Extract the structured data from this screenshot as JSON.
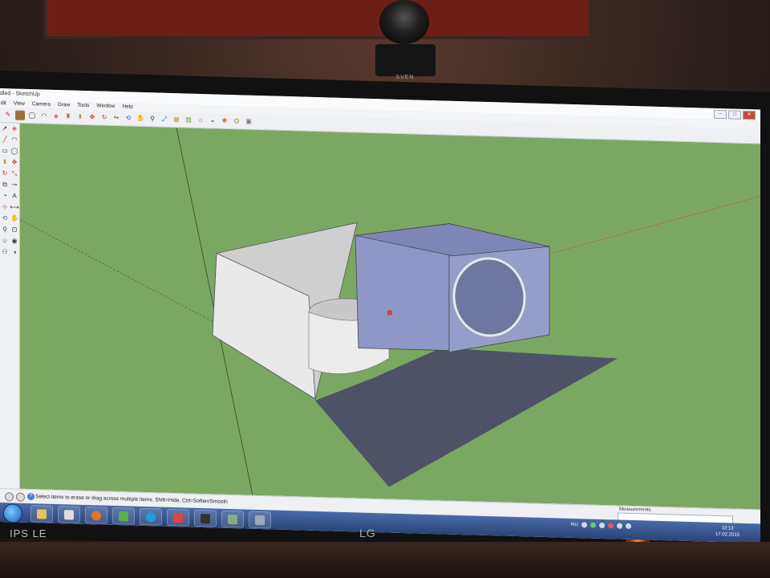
{
  "window": {
    "title": "dled - SketchUp",
    "controls": [
      "–",
      "□",
      "✕"
    ]
  },
  "menu": [
    "dit",
    "View",
    "Camera",
    "Draw",
    "Tools",
    "Window",
    "Help"
  ],
  "toolbar_icons": [
    "pencil-icon",
    "rectangle-icon",
    "circle-icon",
    "arc-icon",
    "eraser-icon",
    "paint-bucket-icon",
    "push-pull-icon",
    "move-icon",
    "rotate-icon",
    "follow-me-icon",
    "orbit-icon",
    "pan-icon",
    "zoom-icon",
    "zoom-extents-icon",
    "components-icon",
    "materials-icon",
    "3d-warehouse-icon",
    "section-plane-icon",
    "sandbox-icon",
    "google-earth-icon",
    "settings-icon"
  ],
  "sidebar_icons": [
    "select-icon",
    "eraser-icon",
    "line-icon",
    "arc-icon",
    "rectangle-icon",
    "circle-icon",
    "push-pull-icon",
    "move-icon",
    "rotate-icon",
    "scale-icon",
    "offset-icon",
    "tape-icon",
    "protractor-icon",
    "text-icon",
    "axes-icon",
    "dimension-icon",
    "orbit-icon",
    "pan-icon",
    "zoom-icon",
    "zoom-window-icon",
    "position-camera-icon",
    "look-around-icon",
    "walk-icon",
    "section-icon"
  ],
  "status": {
    "hint": "Select items to erase or drag across multiple items. Shift=Hide, Ctrl=Soften/Smooth",
    "measurements_label": "Measurements",
    "measurements_value": ""
  },
  "taskbar": {
    "apps": [
      "explorer",
      "firefox",
      "utorrent",
      "skype",
      "sketchup",
      "media",
      "winamp",
      "docs"
    ],
    "tray_lang": "RU",
    "time": "12:13",
    "date": "17.02.2015"
  },
  "bezel": {
    "left_label": "IPS LE",
    "brand": "LG",
    "webcam_brand": "SVEN"
  },
  "colors": {
    "ground": "#7aa862",
    "box_blue": "#8a92c2",
    "box_white": "#e4e4e4",
    "shadow": "#4d5266"
  }
}
